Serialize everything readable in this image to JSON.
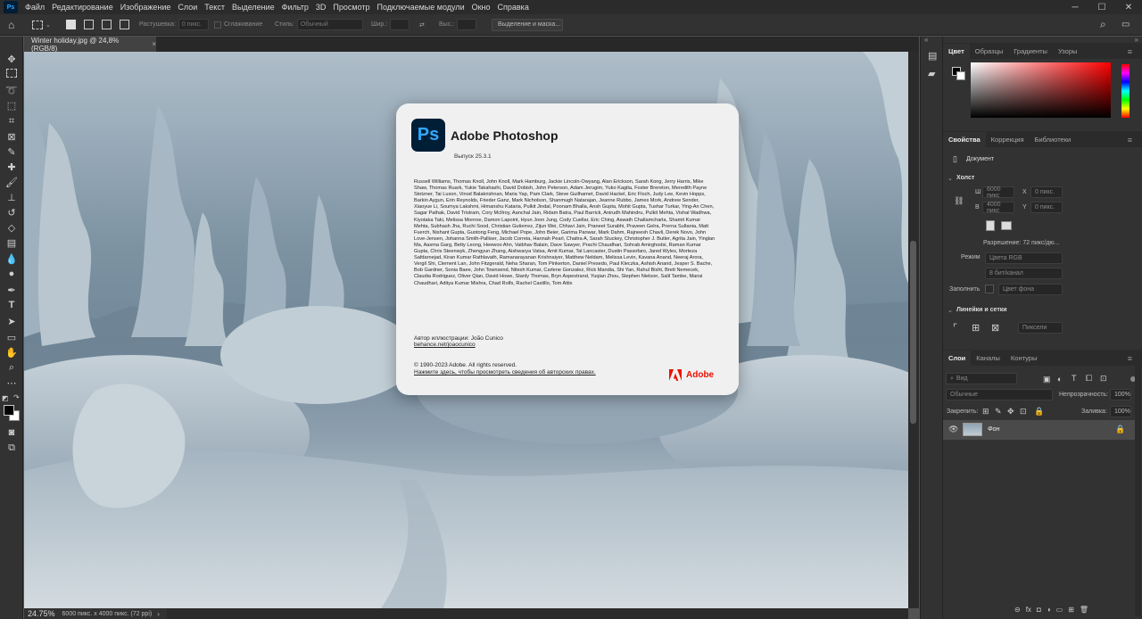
{
  "menubar": {
    "logo": "Ps",
    "items": [
      "Файл",
      "Редактирование",
      "Изображение",
      "Слои",
      "Текст",
      "Выделение",
      "Фильтр",
      "3D",
      "Просмотр",
      "Подключаемые модули",
      "Окно",
      "Справка"
    ]
  },
  "options": {
    "feather_label": "Растушевка:",
    "feather_value": "0 пикс.",
    "antialias_label": "Сглаживание",
    "style_label": "Стиль:",
    "style_value": "Обычный",
    "width_label": "Шир.:",
    "height_label": "Выс.:",
    "select_mask_button": "Выделение и маска..."
  },
  "document": {
    "tab_title": "Winter holiday.jpg @ 24,8% (RGB/8)",
    "tab_close": "×"
  },
  "status": {
    "zoom": "24.75%",
    "info": "6000 пикс. x 4000 пикс. (72 ppi)"
  },
  "about": {
    "logo": "Ps",
    "title": "Adobe Photoshop",
    "version": "Выпуск 25.3.1",
    "credits": "Russell Williams, Thomas Knoll, John Knoll, Mark Hamburg, Jackie Lincoln-Owyang, Alan Erickson, Sarah Kong, Jerry Harris, Mike Shaw, Thomas Ruark, Yukie Takahashi, David Dobish, John Peterson, Adam Jerugim, Yuko Kagita, Foster Brereton, Meredith Payne Stotzner, Tai Luxon, Vinod Balakrishnan, Maria Yap, Pam Clark, Steve Guilhamet, David Hackel, Eric Floch, Judy Lee, Kevin Hopps, Barkin Aygun, Erin Reynolds, Frieder Ganz, Mark Nicholson, Shanmugh Natarajan, Jeanne Rubbo, James Mork, Andrew Sender, Xiaoyue Li, Soumya Lakshmi, Himanshu Kataria, Pulkit Jindal, Poonam Bhalla, Ansh Gupta, Mohit Gupta, Tushar Turkar, Ying-An Chen, Sagar Pathak, David Tristram, Cory McIlroy, Aanchal Jain, Ridam Batra, Paul Barrick, Anirudh Mahindru, Pulkit Mehta, Vishal Wadhwa, Kiyotaka Taki, Melissa Monroe, Damon Lapoint, Hyun Joon Jung, Cody Cuellar, Eric Ching, Aswath Challamcharla, Shamit Kumar Mehta, Subhash Jha, Ruchi Sood, Christian Gutierrez, Zijun Wei, Chhavi Jain, Praneet Surabhi, Praveen Gelra, Prerna Sultania, Matt Fuerch, Nishant Gupta, Guotong Feng, Michael Pope, John Beier, Garima Panwar, Mark Dahm, Rajneesh Chavli, Derek Novo, John Love-Jensen, Johanna Smith-Palliser, Jacob Correia, Hannah Pearl, Chaitra A, Sarah Stuckey, Christopher J. Butler, Agrita Jain, Yinglan Ma, Aasma Garg, Betty Leong, Heewoo Ahn, Vaibhav Balain, Dave Sawyer, Prachi Chaudhari, Sohrab Amirghodsi, Raman Kumar Gupta, Chris Steenwyk, Zhengyun Zhang, Aishwarya Vatsa, Amit Kumar, Tal Lancaster, Dustin Passofaro, Jared Wyles, Morteza Safdarnejad, Kiran Kumar Rathlavath, Ramanarayanan Krishnaiyer, Matthew Neldam, Melissa Levin, Kavana Anand, Neeraj Arora, Vergil Shi, Clement Lan, John Fitzgerald, Neha Sharan, Tom Pinkerton, Daniel Presedo, Paul Kleczka, Ashish Anand, Jesper S. Bache, Bob Gardner, Sonia Baee, John Townsend, Nitesh Kumar, Carlene Gonzalez, Rick Mandia, Shi Yan, Rahul Bisht, Brett Nemecek, Claudia Rodriguez, Oliver Qian, David Howe, Stanly Thomas, Bryn Aspestrand, Yuqian Zhou, Stephen Nielson, Salil Tambe, Mansi Chaudhari, Aditya Kumar Mishra, Chad Rolfs, Rachel Castillo, Tom Attix",
    "illustration_label": "Автор иллюстрации: João Cunico",
    "illustration_link": "behance.net/joaocunico",
    "copyright": "© 1990-2023 Adobe. All rights reserved.",
    "legal_link": "Нажмите здесь, чтобы просмотреть сведения об авторских правах.",
    "adobe_text": "Adobe"
  },
  "panels": {
    "color_tabs": [
      "Цвет",
      "Образцы",
      "Градиенты",
      "Узоры"
    ],
    "props_tabs": [
      "Свойства",
      "Коррекция",
      "Библиотеки"
    ],
    "document_label": "Документ",
    "canvas_section": "Холст",
    "w_label": "Ш",
    "w_value": "6000 пикс",
    "h_label": "В",
    "h_value": "4000 пикс",
    "x_label": "X",
    "x_value": "0 пикс.",
    "y_label": "Y",
    "y_value": "0 пикс.",
    "resolution": "Разрешение: 72 пикс/дю...",
    "mode_label": "Режим",
    "mode_value": "Цвета RGB",
    "bits_value": "8 бит/канал",
    "fill_label": "Заполнить",
    "fill_value": "Цвет фона",
    "rulers_section": "Линейки и сетки",
    "units_value": "Пиксели",
    "layers_tabs": [
      "Слои",
      "Каналы",
      "Контуры"
    ],
    "layer_search": "Вид",
    "blend_mode": "Обычные",
    "opacity_label": "Непрозрачность:",
    "opacity_value": "100%",
    "lock_label": "Закрепить:",
    "fill2_label": "Заливка:",
    "fill2_value": "100%",
    "layer_name": "Фон"
  }
}
